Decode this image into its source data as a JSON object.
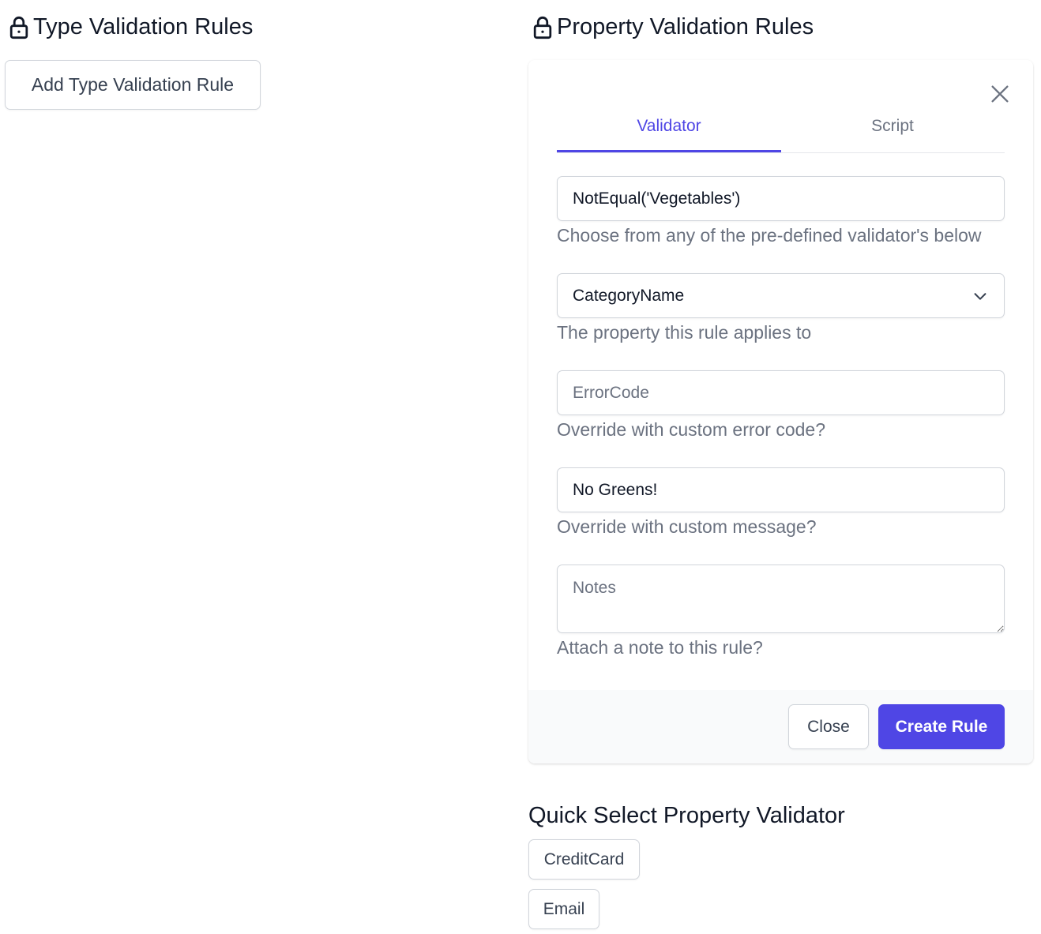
{
  "left_section": {
    "title": "Type Validation Rules",
    "add_button": "Add Type Validation Rule"
  },
  "right_section": {
    "title": "Property Validation Rules"
  },
  "dialog": {
    "tabs": [
      {
        "label": "Validator",
        "active": true
      },
      {
        "label": "Script",
        "active": false
      }
    ],
    "validator": {
      "value": "NotEqual('Vegetables')",
      "help": "Choose from any of the pre-defined validator's below"
    },
    "property": {
      "selected": "CategoryName",
      "help": "The property this rule applies to"
    },
    "error_code": {
      "placeholder": "ErrorCode",
      "value": "",
      "help": "Override with custom error code?"
    },
    "message": {
      "value": "No Greens!",
      "help": "Override with custom message?"
    },
    "notes": {
      "placeholder": "Notes",
      "help": "Attach a note to this rule?"
    },
    "footer": {
      "close_label": "Close",
      "create_label": "Create Rule"
    }
  },
  "quick_select": {
    "title": "Quick Select Property Validator",
    "items": [
      "CreditCard",
      "Email"
    ]
  },
  "colors": {
    "accent": "#4f46e5",
    "text": "#111827",
    "muted": "#6b7280",
    "border": "#d1d5db",
    "footer_bg": "#f9fafb"
  },
  "icons": {
    "lock": "lock-icon",
    "close": "close-icon",
    "select": "chevron-down-icon"
  }
}
